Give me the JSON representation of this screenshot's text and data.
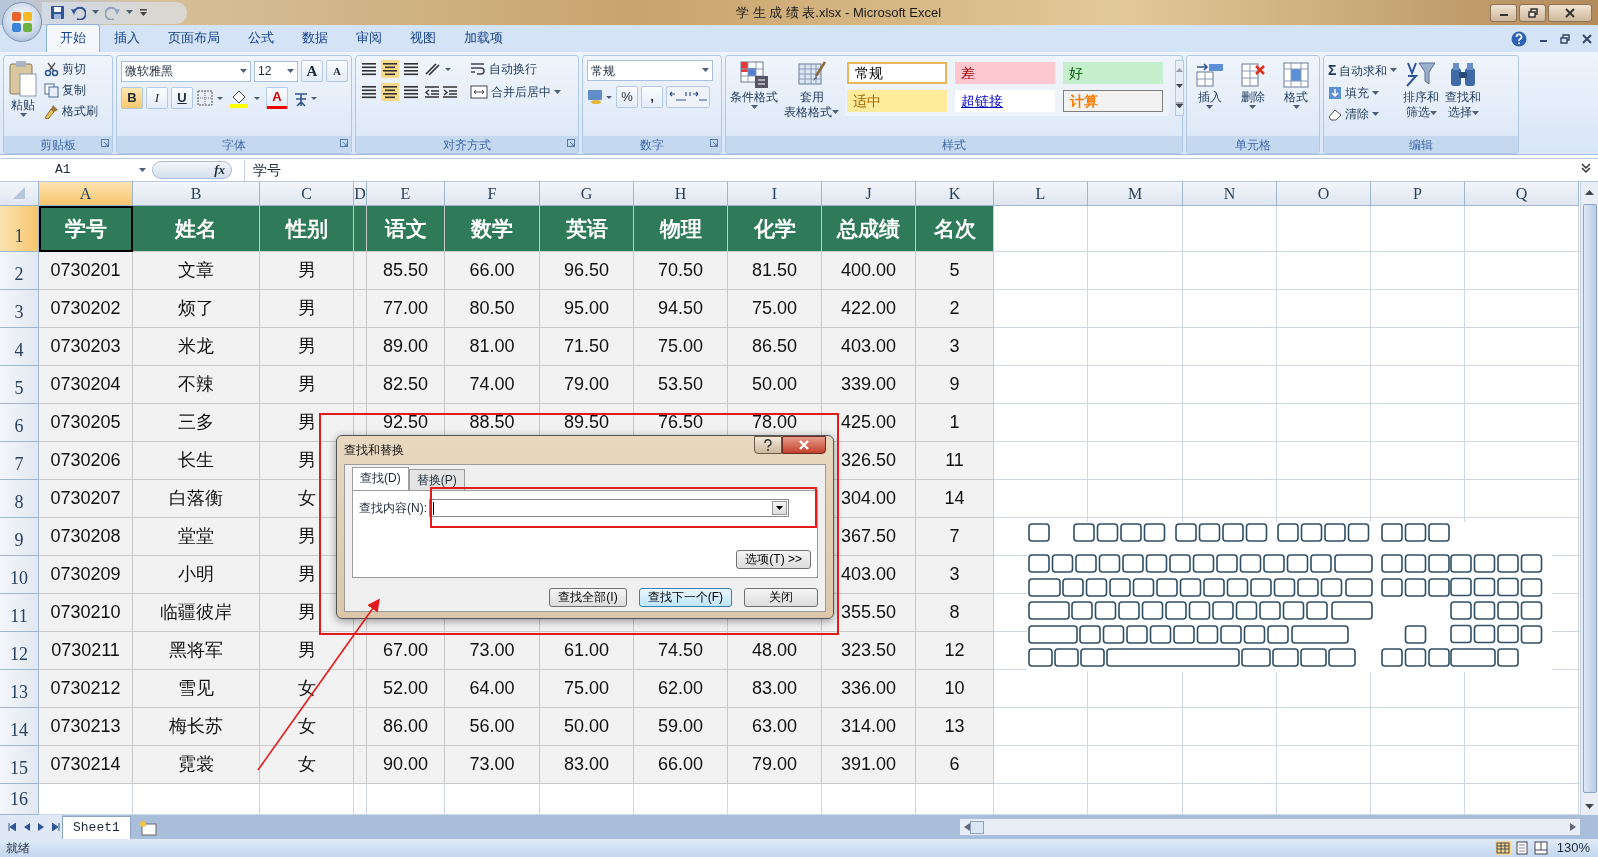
{
  "window": {
    "title": "学 生 成 绩 表.xlsx - Microsoft Excel"
  },
  "ribbon_tabs": [
    {
      "label": "开始",
      "selected": true
    },
    {
      "label": "插入",
      "selected": false
    },
    {
      "label": "页面布局",
      "selected": false
    },
    {
      "label": "公式",
      "selected": false
    },
    {
      "label": "数据",
      "selected": false
    },
    {
      "label": "审阅",
      "selected": false
    },
    {
      "label": "视图",
      "selected": false
    },
    {
      "label": "加载项",
      "selected": false
    }
  ],
  "clipboard": {
    "group": "剪贴板",
    "paste": "粘贴",
    "items": [
      {
        "label": "剪切",
        "kind": "cut"
      },
      {
        "label": "复制",
        "kind": "copy"
      },
      {
        "label": "格式刷",
        "kind": "brush"
      }
    ]
  },
  "font": {
    "group": "字体",
    "name": "微软雅黑",
    "size": "12",
    "grow": "A",
    "shrink": "A",
    "bold": "B",
    "italic": "I",
    "underline": "U",
    "font_color_label": "A"
  },
  "alignment": {
    "group": "对齐方式",
    "wrap": "自动换行",
    "merge": "合并后居中"
  },
  "number": {
    "group": "数字",
    "format": "常规",
    "percent": "%",
    "comma": ","
  },
  "styles": {
    "group": "样式",
    "conditional": "条件格式",
    "table_format": [
      "套用",
      "表格格式"
    ],
    "cells": [
      {
        "label": "常规",
        "kind": "normal"
      },
      {
        "label": "差",
        "kind": "bad"
      },
      {
        "label": "好",
        "kind": "good"
      },
      {
        "label": "适中",
        "kind": "neutral"
      },
      {
        "label": "超链接",
        "kind": "link"
      },
      {
        "label": "计算",
        "kind": "calc"
      }
    ]
  },
  "cells_group": {
    "group": "单元格",
    "items": [
      {
        "label": "插入",
        "kind": "insert"
      },
      {
        "label": "删除",
        "kind": "delete"
      },
      {
        "label": "格式",
        "kind": "format"
      }
    ]
  },
  "editing": {
    "group": "编辑",
    "sigma": "Σ",
    "autosum": "自动求和",
    "fill": "填充",
    "clear": "清除",
    "sort": [
      "排序和",
      "筛选"
    ],
    "find": [
      "查找和",
      "选择"
    ]
  },
  "formula_bar": {
    "name_box": "A1",
    "fx": "fx",
    "content": "学号"
  },
  "sheet": {
    "columns": [
      {
        "label": "A",
        "selected": true
      },
      {
        "label": "B",
        "selected": false
      },
      {
        "label": "C",
        "selected": false
      },
      {
        "label": "D",
        "selected": false
      },
      {
        "label": "E",
        "selected": false
      },
      {
        "label": "F",
        "selected": false
      },
      {
        "label": "G",
        "selected": false
      },
      {
        "label": "H",
        "selected": false
      },
      {
        "label": "I",
        "selected": false
      },
      {
        "label": "J",
        "selected": false
      },
      {
        "label": "K",
        "selected": false
      },
      {
        "label": "L",
        "selected": false
      },
      {
        "label": "M",
        "selected": false
      },
      {
        "label": "N",
        "selected": false
      },
      {
        "label": "O",
        "selected": false
      },
      {
        "label": "P",
        "selected": false
      },
      {
        "label": "Q",
        "selected": false
      }
    ],
    "header_row": {
      "n": "1",
      "selected": true,
      "cells": {
        "A": "学号",
        "B": "姓名",
        "C": "性别",
        "E": "语文",
        "F": "数学",
        "G": "英语",
        "H": "物理",
        "I": "化学",
        "J": "总成绩",
        "K": "名次"
      }
    },
    "rows": [
      {
        "n": "2",
        "selected": false,
        "cells": {
          "A": "0730201",
          "B": "文章",
          "C": "男",
          "E": "85.50",
          "F": "66.00",
          "G": "96.50",
          "H": "70.50",
          "I": "81.50",
          "J": "400.00",
          "K": "5"
        }
      },
      {
        "n": "3",
        "selected": false,
        "cells": {
          "A": "0730202",
          "B": "烦了",
          "C": "男",
          "E": "77.00",
          "F": "80.50",
          "G": "95.00",
          "H": "94.50",
          "I": "75.00",
          "J": "422.00",
          "K": "2"
        }
      },
      {
        "n": "4",
        "selected": false,
        "cells": {
          "A": "0730203",
          "B": "米龙",
          "C": "男",
          "E": "89.00",
          "F": "81.00",
          "G": "71.50",
          "H": "75.00",
          "I": "86.50",
          "J": "403.00",
          "K": "3"
        }
      },
      {
        "n": "5",
        "selected": false,
        "cells": {
          "A": "0730204",
          "B": "不辣",
          "C": "男",
          "E": "82.50",
          "F": "74.00",
          "G": "79.00",
          "H": "53.50",
          "I": "50.00",
          "J": "339.00",
          "K": "9"
        }
      },
      {
        "n": "6",
        "selected": false,
        "cells": {
          "A": "0730205",
          "B": "三多",
          "C": "男",
          "E": "92.50",
          "F": "88.50",
          "G": "89.50",
          "H": "76.50",
          "I": "78.00",
          "J": "425.00",
          "K": "1"
        }
      },
      {
        "n": "7",
        "selected": false,
        "cells": {
          "A": "0730206",
          "B": "长生",
          "C": "男",
          "J": "326.50",
          "K": "11"
        }
      },
      {
        "n": "8",
        "selected": false,
        "cells": {
          "A": "0730207",
          "B": "白落衡",
          "C": "女",
          "J": "304.00",
          "K": "14"
        }
      },
      {
        "n": "9",
        "selected": false,
        "cells": {
          "A": "0730208",
          "B": "堂堂",
          "C": "男",
          "J": "367.50",
          "K": "7"
        }
      },
      {
        "n": "10",
        "selected": false,
        "cells": {
          "A": "0730209",
          "B": "小明",
          "C": "男",
          "J": "403.00",
          "K": "3"
        }
      },
      {
        "n": "11",
        "selected": false,
        "cells": {
          "A": "0730210",
          "B": "临疆彼岸",
          "C": "男",
          "J": "355.50",
          "K": "8"
        }
      },
      {
        "n": "12",
        "selected": false,
        "cells": {
          "A": "0730211",
          "B": "黑将军",
          "C": "男",
          "E": "67.00",
          "F": "73.00",
          "G": "61.00",
          "H": "74.50",
          "I": "48.00",
          "J": "323.50",
          "K": "12"
        }
      },
      {
        "n": "13",
        "selected": false,
        "cells": {
          "A": "0730212",
          "B": "雪见",
          "C": "女",
          "E": "52.00",
          "F": "64.00",
          "G": "75.00",
          "H": "62.00",
          "I": "83.00",
          "J": "336.00",
          "K": "10"
        }
      },
      {
        "n": "14",
        "selected": false,
        "cells": {
          "A": "0730213",
          "B": "梅长苏",
          "C": "女",
          "E": "86.00",
          "F": "56.00",
          "G": "50.00",
          "H": "59.00",
          "I": "63.00",
          "J": "314.00",
          "K": "13"
        }
      },
      {
        "n": "15",
        "selected": false,
        "cells": {
          "A": "0730214",
          "B": "霓裳",
          "C": "女",
          "E": "90.00",
          "F": "73.00",
          "G": "83.00",
          "H": "66.00",
          "I": "79.00",
          "J": "391.00",
          "K": "6"
        }
      },
      {
        "n": "16",
        "selected": false,
        "cells": {}
      }
    ]
  },
  "dialog": {
    "title": "查找和替换",
    "tabs": [
      {
        "label": "查找(D)",
        "selected": true
      },
      {
        "label": "替换(P)",
        "selected": false
      }
    ],
    "field_label": "查找内容(N):",
    "options": "选项(T) >>",
    "buttons": [
      {
        "label": "查找全部(I)",
        "default": false
      },
      {
        "label": "查找下一个(F)",
        "default": true
      },
      {
        "label": "关闭",
        "default": false
      }
    ]
  },
  "sheet_tabs": [
    {
      "label": "Sheet1",
      "selected": true
    }
  ],
  "status_bar": {
    "status": "就绪",
    "zoom": "130%"
  }
}
